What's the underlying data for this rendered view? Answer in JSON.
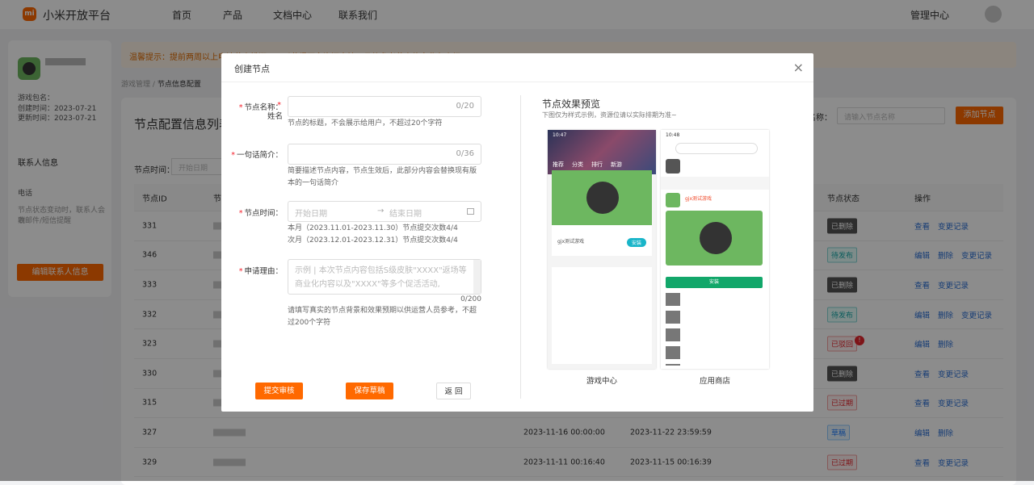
{
  "header": {
    "logo": "mi",
    "brand": "小米开放平台",
    "nav": [
      "首页",
      "产品",
      "文档中心",
      "联系我们"
    ],
    "admin": "管理中心"
  },
  "sidebar": {
    "pkg_label": "游戏包名：",
    "created": "创建时间：2023-07-21",
    "updated": "更新时间：2023-07-21",
    "contact_title": "联系人信息",
    "name_label": "姓名",
    "phone_label": "电话",
    "contact_hint1": "节点状态变动时，联系人会收",
    "contact_hint2": "到邮件/短信提醒",
    "edit_button": "编辑联系人信息"
  },
  "notice": "温馨提示：提前两周以上申请节点排期，可以获得更多资源支持，具体参考节点信息业务介绍",
  "breadcrumb": {
    "parent": "游戏管理",
    "sep": "/",
    "current": "节点信息配置"
  },
  "main": {
    "title": "节点配置信息列表",
    "search_label": "节点名称：",
    "search_placeholder": "请输入节点名称",
    "add_button": "添加节点",
    "time_filter_label": "节点时间：",
    "time_filter_placeholder": "开始日期",
    "columns": [
      "节点ID",
      "节点名称",
      "",
      "",
      "",
      "节点状态",
      "操作"
    ],
    "rows": [
      {
        "id": "331",
        "start": "",
        "end": "",
        "status": "已删除",
        "kind": "deleted",
        "actions": [
          "查看",
          "变更记录"
        ]
      },
      {
        "id": "346",
        "start": "",
        "end": "",
        "status": "待发布",
        "kind": "pending",
        "actions": [
          "编辑",
          "删除",
          "变更记录"
        ]
      },
      {
        "id": "333",
        "start": "",
        "end": "",
        "status": "已删除",
        "kind": "deleted",
        "actions": [
          "查看",
          "变更记录"
        ]
      },
      {
        "id": "332",
        "start": "",
        "end": "",
        "status": "待发布",
        "kind": "pending",
        "actions": [
          "编辑",
          "删除",
          "变更记录"
        ]
      },
      {
        "id": "323",
        "start": "",
        "end": "",
        "status": "已驳回",
        "kind": "rejected",
        "alert": "!",
        "actions": [
          "编辑",
          "删除"
        ]
      },
      {
        "id": "330",
        "start": "",
        "end": "",
        "status": "已删除",
        "kind": "deleted",
        "actions": [
          "查看",
          "变更记录"
        ]
      },
      {
        "id": "315",
        "start": "",
        "end": "",
        "status": "已过期",
        "kind": "expired",
        "actions": [
          "查看",
          "变更记录"
        ]
      },
      {
        "id": "327",
        "start": "2023-11-16 00:00:00",
        "end": "2023-11-22 23:59:59",
        "status": "草稿",
        "kind": "draft",
        "actions": [
          "编辑",
          "删除"
        ]
      },
      {
        "id": "329",
        "start": "2023-11-11 00:16:40",
        "end": "2023-11-15 00:16:39",
        "status": "已过期",
        "kind": "expired",
        "actions": [
          "查看",
          "变更记录"
        ]
      }
    ]
  },
  "modal": {
    "title": "创建节点",
    "close": "×",
    "name": {
      "label": "节点名称：",
      "count": "0/20",
      "hint": "节点的标题，不会展示给用户，不超过20个字符"
    },
    "intro": {
      "label": "一句话简介：",
      "count": "0/36",
      "hint": "简要描述节点内容，节点生效后，此部分内容会替换现有版本的一句话简介"
    },
    "time": {
      "label": "节点时间：",
      "start_placeholder": "开始日期",
      "arrow": "→",
      "end_placeholder": "结束日期",
      "hint1": "本月（2023.11.01-2023.11.30）节点提交次数4/4",
      "hint2": "次月（2023.12.01-2023.12.31）节点提交次数4/4"
    },
    "reason": {
      "label": "申请理由：",
      "placeholder": "示例 | 本次节点内容包括S级皮肤\"XXXX\"返场等商业化内容以及\"XXXX\"等多个促活活动,",
      "count": "0/200",
      "hint": "请填写真实的节点背景和效果预期以供运营人员参考，不超过200个字符"
    },
    "buttons": {
      "submit": "提交审核",
      "save": "保存草稿",
      "back": "返 回"
    },
    "preview": {
      "title": "节点效果预览",
      "subtitle": "下图仅为样式示例，资源位请以实际排期为准~",
      "game_center": {
        "time": "10:47",
        "tabs": [
          "推荐",
          "分类",
          "排行",
          "新游"
        ],
        "game_name": "gjx测试游戏",
        "install": "安装",
        "caption": "游戏中心"
      },
      "app_store": {
        "time": "10:48",
        "game_name": "gjx测试游戏",
        "install": "安装",
        "caption": "应用商店"
      }
    }
  },
  "colors": {
    "accent": "#ff6900",
    "link": "#2a6fd6"
  }
}
